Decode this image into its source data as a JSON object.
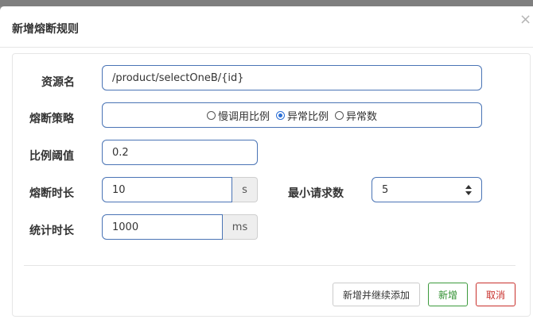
{
  "dialog": {
    "title": "新增熔断规则",
    "close_glyph": "×"
  },
  "form": {
    "resource_name": {
      "label": "资源名",
      "value": "/product/selectOneB/{id}"
    },
    "strategy": {
      "label": "熔断策略",
      "options": [
        "慢调用比例",
        "异常比例",
        "异常数"
      ],
      "selected": "异常比例"
    },
    "ratio_threshold": {
      "label": "比例阈值",
      "value": "0.2"
    },
    "break_duration": {
      "label": "熔断时长",
      "value": "10",
      "unit": "s"
    },
    "min_request": {
      "label": "最小请求数",
      "value": "5"
    },
    "stat_duration": {
      "label": "统计时长",
      "value": "1000",
      "unit": "ms"
    }
  },
  "footer": {
    "add_continue": "新增并继续添加",
    "add": "新增",
    "cancel": "取消"
  },
  "colors": {
    "input_border": "#4a74b5",
    "success": "#3c9a3c",
    "danger": "#c9302c",
    "radio_checked": "#2c6fd6"
  }
}
